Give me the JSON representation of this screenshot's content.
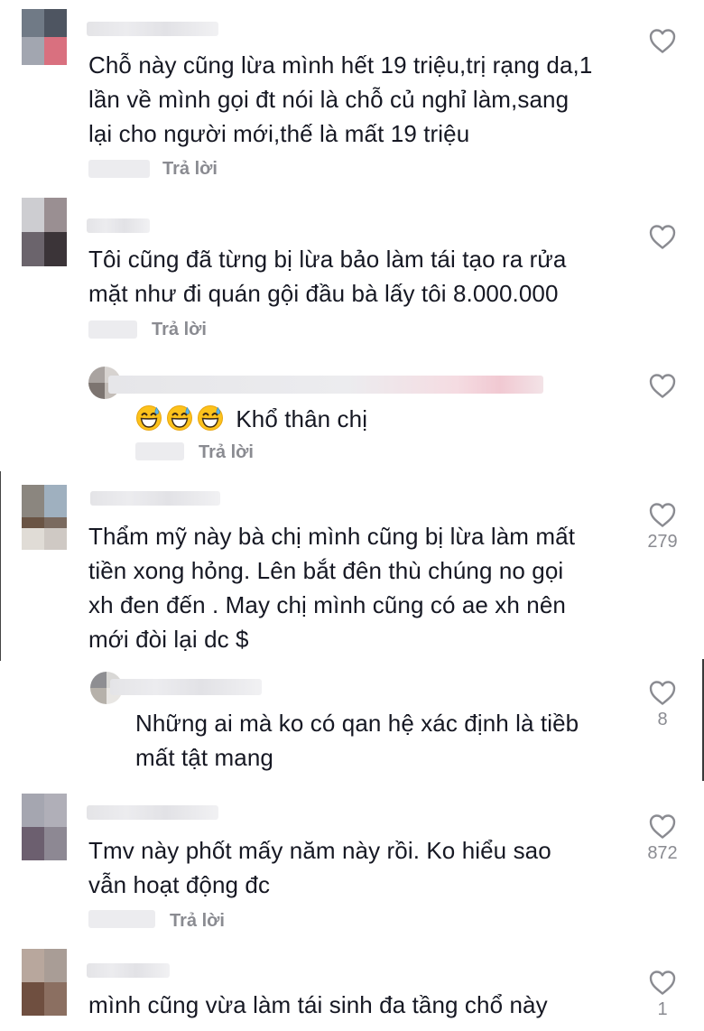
{
  "icons": {
    "like": "heart-outline-icon",
    "emoji": "grinning-sweat-emoji"
  },
  "colors": {
    "text": "#161823",
    "muted": "#8a8b91",
    "heart": "#8a8b91"
  },
  "comments": [
    {
      "text_lines": [
        "Chỗ này cũng lừa mình hết 19 triệu,trị rạng da,1",
        "lần về mình gọi đt nói là chỗ củ nghỉ làm,sang",
        "lại cho người mới,thế là mất 19 triệu"
      ],
      "reply_label": "Trả lời",
      "like_count": ""
    },
    {
      "text_lines": [
        "Tôi cũng đã từng bị lừa bảo làm tái tạo ra rửa",
        "mặt như đi quán gội đầu bà lấy tôi 8.000.000"
      ],
      "reply_label": "Trả lời",
      "like_count": ""
    },
    {
      "text_lines": [
        "Khổ thân chị"
      ],
      "emoji_count": 3,
      "reply_label": "Trả lời",
      "like_count": ""
    },
    {
      "text_lines": [
        "Thẩm mỹ này bà chị mình cũng bị lừa làm mất",
        "tiền xong hỏng. Lên bắt đên thù chúng no gọi",
        "xh đen đến . May chị mình cũng có ae xh nên",
        "mới đòi lại dc $"
      ],
      "reply_label": "",
      "like_count": "279"
    },
    {
      "text_lines": [
        "Những ai mà ko có qan hệ xác định là tiềb",
        "mất tật mang"
      ],
      "reply_label": "",
      "like_count": "8"
    },
    {
      "text_lines": [
        "Tmv này phốt mấy năm này rồi. Ko hiểu sao",
        "vẫn hoạt động đc"
      ],
      "reply_label": "Trả lời",
      "like_count": "872"
    },
    {
      "text_lines": [
        "mình cũng vừa làm tái sinh đa tầng chổ này"
      ],
      "reply_label": "",
      "like_count": "1"
    }
  ]
}
